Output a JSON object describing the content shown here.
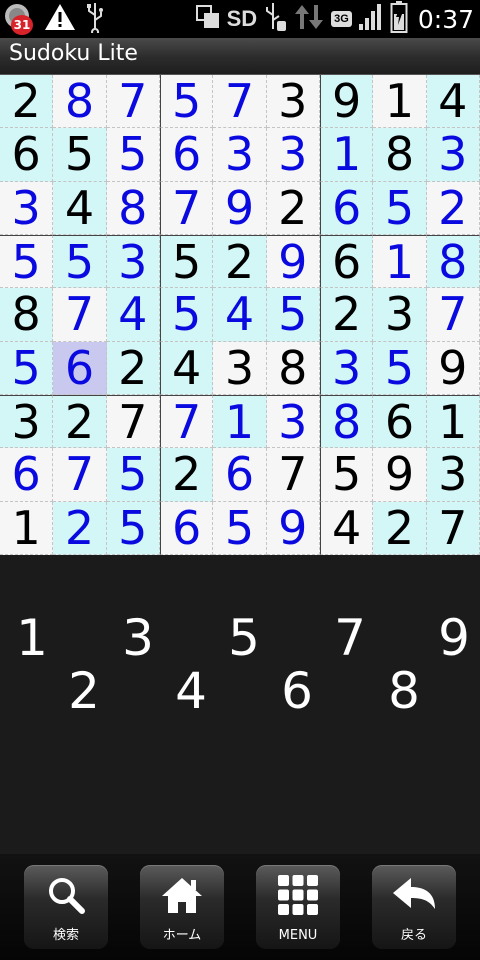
{
  "status_bar": {
    "calendar_badge": "31",
    "sd_label": "SD",
    "network_label": "3G",
    "time": "0:37"
  },
  "app": {
    "title": "Sudoku Lite"
  },
  "board": {
    "rows": [
      [
        "2",
        "8",
        "7",
        "5",
        "7",
        "3",
        "9",
        "1",
        "4"
      ],
      [
        "6",
        "5",
        "5",
        "6",
        "3",
        "3",
        "1",
        "8",
        "3"
      ],
      [
        "3",
        "4",
        "8",
        "7",
        "9",
        "2",
        "6",
        "5",
        "2"
      ],
      [
        "5",
        "5",
        "3",
        "5",
        "2",
        "9",
        "6",
        "1",
        "8"
      ],
      [
        "8",
        "7",
        "4",
        "5",
        "4",
        "5",
        "2",
        "3",
        "7"
      ],
      [
        "5",
        "6",
        "2",
        "4",
        "3",
        "8",
        "3",
        "5",
        "9"
      ],
      [
        "3",
        "2",
        "7",
        "7",
        "1",
        "3",
        "8",
        "6",
        "1"
      ],
      [
        "6",
        "7",
        "5",
        "2",
        "6",
        "7",
        "5",
        "9",
        "3"
      ],
      [
        "1",
        "2",
        "5",
        "6",
        "5",
        "9",
        "4",
        "2",
        "7"
      ]
    ],
    "user_entries": [
      [
        false,
        true,
        true,
        true,
        true,
        false,
        false,
        false,
        false
      ],
      [
        false,
        false,
        true,
        true,
        true,
        true,
        true,
        false,
        true
      ],
      [
        true,
        false,
        true,
        true,
        true,
        false,
        true,
        true,
        true
      ],
      [
        true,
        true,
        true,
        false,
        false,
        true,
        false,
        true,
        true
      ],
      [
        false,
        true,
        true,
        true,
        true,
        true,
        false,
        false,
        true
      ],
      [
        true,
        true,
        false,
        false,
        false,
        false,
        true,
        true,
        false
      ],
      [
        false,
        false,
        false,
        true,
        true,
        true,
        true,
        false,
        false
      ],
      [
        true,
        true,
        true,
        false,
        true,
        false,
        false,
        false,
        false
      ],
      [
        false,
        true,
        true,
        true,
        true,
        true,
        false,
        false,
        false
      ]
    ],
    "cell_backgrounds": [
      [
        "c",
        "w",
        "w",
        "w",
        "w",
        "w",
        "c",
        "w",
        "c"
      ],
      [
        "c",
        "c",
        "w",
        "w",
        "w",
        "w",
        "c",
        "c",
        "c"
      ],
      [
        "w",
        "c",
        "w",
        "w",
        "w",
        "w",
        "c",
        "c",
        "w"
      ],
      [
        "w",
        "c",
        "c",
        "c",
        "c",
        "w",
        "c",
        "w",
        "c"
      ],
      [
        "c",
        "w",
        "c",
        "c",
        "c",
        "c",
        "c",
        "c",
        "w"
      ],
      [
        "c",
        "s",
        "c",
        "c",
        "w",
        "w",
        "c",
        "c",
        "w"
      ],
      [
        "c",
        "c",
        "w",
        "w",
        "c",
        "w",
        "c",
        "c",
        "c"
      ],
      [
        "w",
        "w",
        "c",
        "c",
        "w",
        "w",
        "w",
        "w",
        "c"
      ],
      [
        "w",
        "c",
        "c",
        "w",
        "w",
        "w",
        "w",
        "c",
        "c"
      ]
    ],
    "given_color": "#000000",
    "user_color": "#0a0ae0",
    "selected_cell": {
      "row": 6,
      "col": 2
    }
  },
  "numpad": {
    "top_row": [
      "1",
      "3",
      "5",
      "7",
      "9"
    ],
    "bottom_row": [
      "2",
      "4",
      "6",
      "8"
    ]
  },
  "navbar": {
    "search_label": "検索",
    "home_label": "ホーム",
    "menu_label": "MENU",
    "back_label": "戻る"
  }
}
